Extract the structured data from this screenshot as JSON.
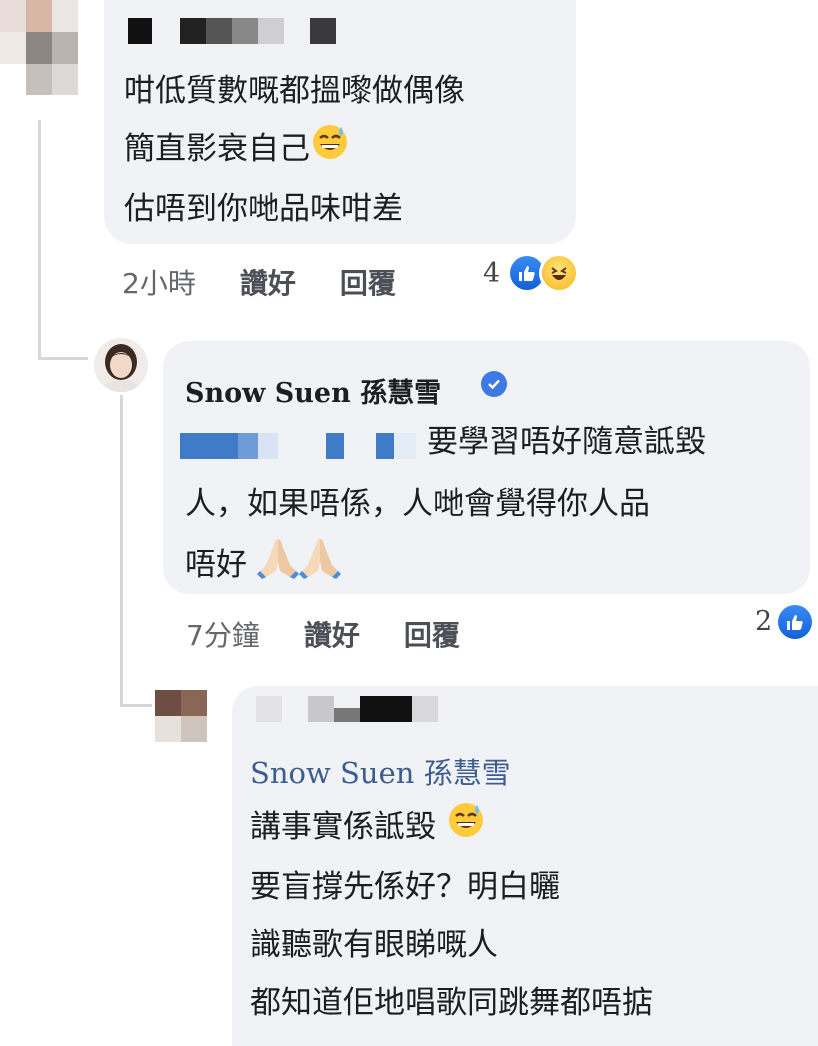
{
  "colors": {
    "bubble_bg": "#f0f2f5",
    "like_blue": "#1877f2",
    "verified": "#3d7be3",
    "mention": "#3b5d8f",
    "meta_text": "#65676b"
  },
  "comment1": {
    "lines": [
      "咁低質數嘅都搵嚟做偶像",
      "簡直影衰自己",
      "估唔到你哋品味咁差"
    ],
    "time": "2小時",
    "like_label": "讚好",
    "reply_label": "回覆",
    "reaction_count": "4",
    "reactions": [
      "like-icon",
      "haha-icon"
    ]
  },
  "reply1": {
    "author": "Snow Suen 孫慧雪",
    "verified": true,
    "lines": [
      "要學習唔好隨意詆毀",
      "人，如果唔係，人哋會覺得你人品",
      "唔好"
    ],
    "time": "7分鐘",
    "like_label": "讚好",
    "reply_label": "回覆",
    "reaction_count": "2",
    "reactions": [
      "like-icon"
    ]
  },
  "reply2": {
    "mention": "Snow Suen 孫慧雪",
    "lines": [
      "講事實係詆毀",
      "要盲撐先係好？明白曬",
      "識聽歌有眼睇嘅人",
      "都知道佢地唱歌同跳舞都唔掂"
    ]
  }
}
